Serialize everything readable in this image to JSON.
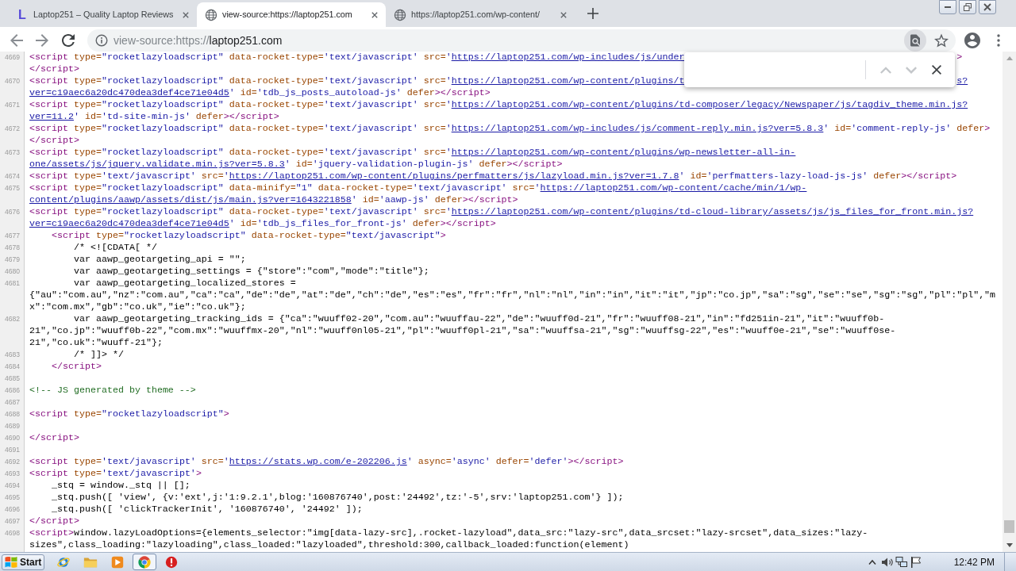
{
  "browser": {
    "tabs": [
      {
        "kind": "logo",
        "logo_letter": "L",
        "title": "Laptop251 – Quality Laptop Reviews",
        "selected": false
      },
      {
        "kind": "globe",
        "title": "view-source:https://laptop251.com",
        "selected": true
      },
      {
        "kind": "globe",
        "title": "https://laptop251.com/wp-content/",
        "selected": false
      }
    ],
    "address_bar": {
      "url_prefix": "view-source:https://",
      "url_host": "laptop251.com",
      "find_button_active": true
    },
    "find_bar": {
      "navigation_disabled": true
    }
  },
  "source": {
    "lines": [
      {
        "number": "4669",
        "rows": [
          {
            "tokens": [
              {
                "kind": "tag",
                "text": "<script"
              },
              {
                "kind": "attr",
                "text": " type="
              },
              {
                "kind": "value",
                "text": "\"rocketlazyloadscript\""
              },
              {
                "kind": "attr",
                "text": " data-rocket-type="
              },
              {
                "kind": "value",
                "text": "'text/javascript'"
              },
              {
                "kind": "attr",
                "text": " src="
              },
              {
                "kind": "value",
                "text": "'"
              },
              {
                "kind": "link",
                "text": "https://laptop251.com/wp-includes/js/under"
              }
            ],
            "tail": [
              {
                "kind": "tag",
                "text": ">"
              }
            ]
          },
          {
            "tokens": [
              {
                "kind": "tag",
                "text": "</script>"
              }
            ]
          }
        ]
      },
      {
        "number": "4670",
        "rows": [
          {
            "tokens": [
              {
                "kind": "tag",
                "text": "<script"
              },
              {
                "kind": "attr",
                "text": " type="
              },
              {
                "kind": "value",
                "text": "\"rocketlazyloadscript\""
              },
              {
                "kind": "attr",
                "text": " data-rocket-type="
              },
              {
                "kind": "value",
                "text": "'text/javascript'"
              },
              {
                "kind": "attr",
                "text": " src="
              },
              {
                "kind": "value",
                "text": "'"
              },
              {
                "kind": "link",
                "text": "https://laptop251.com/wp-content/plugins/t"
              }
            ],
            "tail": [
              {
                "kind": "link",
                "text": "s?"
              }
            ]
          },
          {
            "tokens": [
              {
                "kind": "link",
                "text": "ver=c19aec6a20dc470dea3def4ce71e04d5"
              },
              {
                "kind": "value",
                "text": "'"
              },
              {
                "kind": "attr",
                "text": " id="
              },
              {
                "kind": "value",
                "text": "'tdb_js_posts_autoload-js'"
              },
              {
                "kind": "attr",
                "text": " defer"
              },
              {
                "kind": "tag",
                "text": "></script>"
              }
            ]
          }
        ]
      },
      {
        "number": "4671",
        "rows": [
          {
            "tokens": [
              {
                "kind": "tag",
                "text": "<script"
              },
              {
                "kind": "attr",
                "text": " type="
              },
              {
                "kind": "value",
                "text": "\"rocketlazyloadscript\""
              },
              {
                "kind": "attr",
                "text": " data-rocket-type="
              },
              {
                "kind": "value",
                "text": "'text/javascript'"
              },
              {
                "kind": "attr",
                "text": " src="
              },
              {
                "kind": "value",
                "text": "'"
              },
              {
                "kind": "link",
                "text": "https://laptop251.com/wp-content/plugins/td-composer/legacy/Newspaper/js/tagdiv_theme.min.js?"
              }
            ]
          },
          {
            "tokens": [
              {
                "kind": "link",
                "text": "ver=11.2"
              },
              {
                "kind": "value",
                "text": "'"
              },
              {
                "kind": "attr",
                "text": " id="
              },
              {
                "kind": "value",
                "text": "'td-site-min-js'"
              },
              {
                "kind": "attr",
                "text": " defer"
              },
              {
                "kind": "tag",
                "text": "></script>"
              }
            ]
          }
        ]
      },
      {
        "number": "4672",
        "rows": [
          {
            "tokens": [
              {
                "kind": "tag",
                "text": "<script"
              },
              {
                "kind": "attr",
                "text": " type="
              },
              {
                "kind": "value",
                "text": "\"rocketlazyloadscript\""
              },
              {
                "kind": "attr",
                "text": " data-rocket-type="
              },
              {
                "kind": "value",
                "text": "'text/javascript'"
              },
              {
                "kind": "attr",
                "text": " src="
              },
              {
                "kind": "value",
                "text": "'"
              },
              {
                "kind": "link",
                "text": "https://laptop251.com/wp-includes/js/comment-reply.min.js?ver=5.8.3"
              },
              {
                "kind": "value",
                "text": "'"
              },
              {
                "kind": "attr",
                "text": " id="
              },
              {
                "kind": "value",
                "text": "'comment-reply-js'"
              },
              {
                "kind": "attr",
                "text": " defer"
              },
              {
                "kind": "tag",
                "text": ">"
              }
            ]
          },
          {
            "tokens": [
              {
                "kind": "tag",
                "text": "</script>"
              }
            ]
          }
        ]
      },
      {
        "number": "4673",
        "rows": [
          {
            "tokens": [
              {
                "kind": "tag",
                "text": "<script"
              },
              {
                "kind": "attr",
                "text": " type="
              },
              {
                "kind": "value",
                "text": "\"rocketlazyloadscript\""
              },
              {
                "kind": "attr",
                "text": " data-rocket-type="
              },
              {
                "kind": "value",
                "text": "'text/javascript'"
              },
              {
                "kind": "attr",
                "text": " src="
              },
              {
                "kind": "value",
                "text": "'"
              },
              {
                "kind": "link",
                "text": "https://laptop251.com/wp-content/plugins/wp-newsletter-all-in-"
              }
            ]
          },
          {
            "tokens": [
              {
                "kind": "link",
                "text": "one/assets/js/jquery.validate.min.js?ver=5.8.3"
              },
              {
                "kind": "value",
                "text": "'"
              },
              {
                "kind": "attr",
                "text": " id="
              },
              {
                "kind": "value",
                "text": "'jquery-validation-plugin-js'"
              },
              {
                "kind": "attr",
                "text": " defer"
              },
              {
                "kind": "tag",
                "text": "></script>"
              }
            ]
          }
        ]
      },
      {
        "number": "4674",
        "rows": [
          {
            "tokens": [
              {
                "kind": "tag",
                "text": "<script"
              },
              {
                "kind": "attr",
                "text": " type="
              },
              {
                "kind": "value",
                "text": "'text/javascript'"
              },
              {
                "kind": "attr",
                "text": " src="
              },
              {
                "kind": "value",
                "text": "'"
              },
              {
                "kind": "link",
                "text": "https://laptop251.com/wp-content/plugins/perfmatters/js/lazyload.min.js?ver=1.7.8"
              },
              {
                "kind": "value",
                "text": "'"
              },
              {
                "kind": "attr",
                "text": " id="
              },
              {
                "kind": "value",
                "text": "'perfmatters-lazy-load-js-js'"
              },
              {
                "kind": "attr",
                "text": " defer"
              },
              {
                "kind": "tag",
                "text": "></script>"
              }
            ]
          }
        ]
      },
      {
        "number": "4675",
        "rows": [
          {
            "tokens": [
              {
                "kind": "tag",
                "text": "<script"
              },
              {
                "kind": "attr",
                "text": " type="
              },
              {
                "kind": "value",
                "text": "\"rocketlazyloadscript\""
              },
              {
                "kind": "attr",
                "text": " data-minify="
              },
              {
                "kind": "value",
                "text": "\"1\""
              },
              {
                "kind": "attr",
                "text": " data-rocket-type="
              },
              {
                "kind": "value",
                "text": "'text/javascript'"
              },
              {
                "kind": "attr",
                "text": " src="
              },
              {
                "kind": "value",
                "text": "'"
              },
              {
                "kind": "link",
                "text": "https://laptop251.com/wp-content/cache/min/1/wp-"
              }
            ]
          },
          {
            "tokens": [
              {
                "kind": "link",
                "text": "content/plugins/aawp/assets/dist/js/main.js?ver=1643221858"
              },
              {
                "kind": "value",
                "text": "'"
              },
              {
                "kind": "attr",
                "text": " id="
              },
              {
                "kind": "value",
                "text": "'aawp-js'"
              },
              {
                "kind": "attr",
                "text": " defer"
              },
              {
                "kind": "tag",
                "text": "></script>"
              }
            ]
          }
        ]
      },
      {
        "number": "4676",
        "rows": [
          {
            "tokens": [
              {
                "kind": "tag",
                "text": "<script"
              },
              {
                "kind": "attr",
                "text": " type="
              },
              {
                "kind": "value",
                "text": "\"rocketlazyloadscript\""
              },
              {
                "kind": "attr",
                "text": " data-rocket-type="
              },
              {
                "kind": "value",
                "text": "'text/javascript'"
              },
              {
                "kind": "attr",
                "text": " src="
              },
              {
                "kind": "value",
                "text": "'"
              },
              {
                "kind": "link",
                "text": "https://laptop251.com/wp-content/plugins/td-cloud-library/assets/js/js_files_for_front.min.js?"
              }
            ]
          },
          {
            "tokens": [
              {
                "kind": "link",
                "text": "ver=c19aec6a20dc470dea3def4ce71e04d5"
              },
              {
                "kind": "value",
                "text": "'"
              },
              {
                "kind": "attr",
                "text": " id="
              },
              {
                "kind": "value",
                "text": "'tdb_js_files_for_front-js'"
              },
              {
                "kind": "attr",
                "text": " defer"
              },
              {
                "kind": "tag",
                "text": "></script>"
              }
            ]
          }
        ]
      },
      {
        "number": "4677",
        "rows": [
          {
            "tokens": [
              {
                "kind": "tag",
                "text": "    <script"
              },
              {
                "kind": "attr",
                "text": " type="
              },
              {
                "kind": "value",
                "text": "\"rocketlazyloadscript\""
              },
              {
                "kind": "attr",
                "text": " data-rocket-type="
              },
              {
                "kind": "value",
                "text": "\"text/javascript\""
              },
              {
                "kind": "tag",
                "text": ">"
              }
            ]
          }
        ]
      },
      {
        "number": "4678",
        "rows": [
          {
            "tokens": [
              {
                "kind": "text",
                "text": "        /* <![CDATA[ */"
              }
            ]
          }
        ]
      },
      {
        "number": "4679",
        "rows": [
          {
            "tokens": [
              {
                "kind": "text",
                "text": "        var aawp_geotargeting_api = \"\";"
              }
            ]
          }
        ]
      },
      {
        "number": "4680",
        "rows": [
          {
            "tokens": [
              {
                "kind": "text",
                "text": "        var aawp_geotargeting_settings = {\"store\":\"com\",\"mode\":\"title\"};"
              }
            ]
          }
        ]
      },
      {
        "number": "4681",
        "rows": [
          {
            "tokens": [
              {
                "kind": "text",
                "text": "        var aawp_geotargeting_localized_stores ="
              }
            ]
          },
          {
            "tokens": [
              {
                "kind": "text",
                "text": "{\"au\":\"com.au\",\"nz\":\"com.au\",\"ca\":\"ca\",\"de\":\"de\",\"at\":\"de\",\"ch\":\"de\",\"es\":\"es\",\"fr\":\"fr\",\"nl\":\"nl\",\"in\":\"in\",\"it\":\"it\",\"jp\":\"co.jp\",\"sa\":\"sg\",\"se\":\"se\",\"sg\":\"sg\",\"pl\":\"pl\",\"m"
              }
            ]
          },
          {
            "tokens": [
              {
                "kind": "text",
                "text": "x\":\"com.mx\",\"gb\":\"co.uk\",\"ie\":\"co.uk\"};"
              }
            ]
          }
        ]
      },
      {
        "number": "4682",
        "rows": [
          {
            "tokens": [
              {
                "kind": "text",
                "text": "        var aawp_geotargeting_tracking_ids = {\"ca\":\"wuuff02-20\",\"com.au\":\"wuuffau-22\",\"de\":\"wuuff0d-21\",\"fr\":\"wuuff08-21\",\"in\":\"fd251in-21\",\"it\":\"wuuff0b-"
              }
            ]
          },
          {
            "tokens": [
              {
                "kind": "text",
                "text": "21\",\"co.jp\":\"wuuff0b-22\",\"com.mx\":\"wuuffmx-20\",\"nl\":\"wuuff0nl05-21\",\"pl\":\"wuuff0pl-21\",\"sa\":\"wuuffsa-21\",\"sg\":\"wuuffsg-22\",\"es\":\"wuuff0e-21\",\"se\":\"wuuff0se-"
              }
            ]
          },
          {
            "tokens": [
              {
                "kind": "text",
                "text": "21\",\"co.uk\":\"wuuff-21\"};"
              }
            ]
          }
        ]
      },
      {
        "number": "4683",
        "rows": [
          {
            "tokens": [
              {
                "kind": "text",
                "text": "        /* ]]> */"
              }
            ]
          }
        ]
      },
      {
        "number": "4684",
        "rows": [
          {
            "tokens": [
              {
                "kind": "tag",
                "text": "    </script>"
              }
            ]
          }
        ]
      },
      {
        "number": "4685"
      },
      {
        "number": "4686",
        "rows": [
          {
            "tokens": [
              {
                "kind": "comment",
                "text": "<!-- JS generated by theme -->"
              }
            ]
          }
        ]
      },
      {
        "number": "4687"
      },
      {
        "number": "4688",
        "rows": [
          {
            "tokens": [
              {
                "kind": "tag",
                "text": "<script"
              },
              {
                "kind": "attr",
                "text": " type="
              },
              {
                "kind": "value",
                "text": "\"rocketlazyloadscript\""
              },
              {
                "kind": "tag",
                "text": ">"
              }
            ]
          }
        ]
      },
      {
        "number": "4689"
      },
      {
        "number": "4690",
        "rows": [
          {
            "tokens": [
              {
                "kind": "tag",
                "text": "</script>"
              }
            ]
          }
        ]
      },
      {
        "number": "4691"
      },
      {
        "number": "4692",
        "rows": [
          {
            "tokens": [
              {
                "kind": "tag",
                "text": "<script"
              },
              {
                "kind": "attr",
                "text": " type="
              },
              {
                "kind": "value",
                "text": "'text/javascript'"
              },
              {
                "kind": "attr",
                "text": " src="
              },
              {
                "kind": "value",
                "text": "'"
              },
              {
                "kind": "link",
                "text": "https://stats.wp.com/e-202206.js"
              },
              {
                "kind": "value",
                "text": "'"
              },
              {
                "kind": "attr",
                "text": " async="
              },
              {
                "kind": "value",
                "text": "'async'"
              },
              {
                "kind": "attr",
                "text": " defer="
              },
              {
                "kind": "value",
                "text": "'defer'"
              },
              {
                "kind": "tag",
                "text": "></script>"
              }
            ]
          }
        ]
      },
      {
        "number": "4693",
        "rows": [
          {
            "tokens": [
              {
                "kind": "tag",
                "text": "<script"
              },
              {
                "kind": "attr",
                "text": " type="
              },
              {
                "kind": "value",
                "text": "'text/javascript'"
              },
              {
                "kind": "tag",
                "text": ">"
              }
            ]
          }
        ]
      },
      {
        "number": "4694",
        "rows": [
          {
            "tokens": [
              {
                "kind": "text",
                "text": "    _stq = window._stq || [];"
              }
            ]
          }
        ]
      },
      {
        "number": "4695",
        "rows": [
          {
            "tokens": [
              {
                "kind": "text",
                "text": "    _stq.push([ 'view', {v:'ext',j:'1:9.2.1',blog:'160876740',post:'24492',tz:'-5',srv:'laptop251.com'} ]);"
              }
            ]
          }
        ]
      },
      {
        "number": "4696",
        "rows": [
          {
            "tokens": [
              {
                "kind": "text",
                "text": "    _stq.push([ 'clickTrackerInit', '160876740', '24492' ]);"
              }
            ]
          }
        ]
      },
      {
        "number": "4697",
        "rows": [
          {
            "tokens": [
              {
                "kind": "tag",
                "text": "</script>"
              }
            ]
          }
        ]
      },
      {
        "number": "4698",
        "rows": [
          {
            "tokens": [
              {
                "kind": "tag",
                "text": "<script>"
              },
              {
                "kind": "text",
                "text": "window.lazyLoadOptions={elements_selector:\"img[data-lazy-src],.rocket-lazyload\",data_src:\"lazy-src\",data_srcset:\"lazy-srcset\",data_sizes:\"lazy-"
              }
            ]
          },
          {
            "tokens": [
              {
                "kind": "text",
                "text": "sizes\",class_loading:\"lazyloading\",class_loaded:\"lazyloaded\",threshold:300,callback_loaded:function(element)"
              }
            ]
          }
        ]
      }
    ]
  },
  "taskbar": {
    "start_label": "Start",
    "apps": [
      {
        "kind": "ie",
        "selected": false
      },
      {
        "kind": "folder",
        "selected": false
      },
      {
        "kind": "media",
        "selected": false
      },
      {
        "kind": "chrome",
        "selected": true
      },
      {
        "kind": "alert",
        "selected": false
      }
    ],
    "clock": "12:42 PM"
  }
}
